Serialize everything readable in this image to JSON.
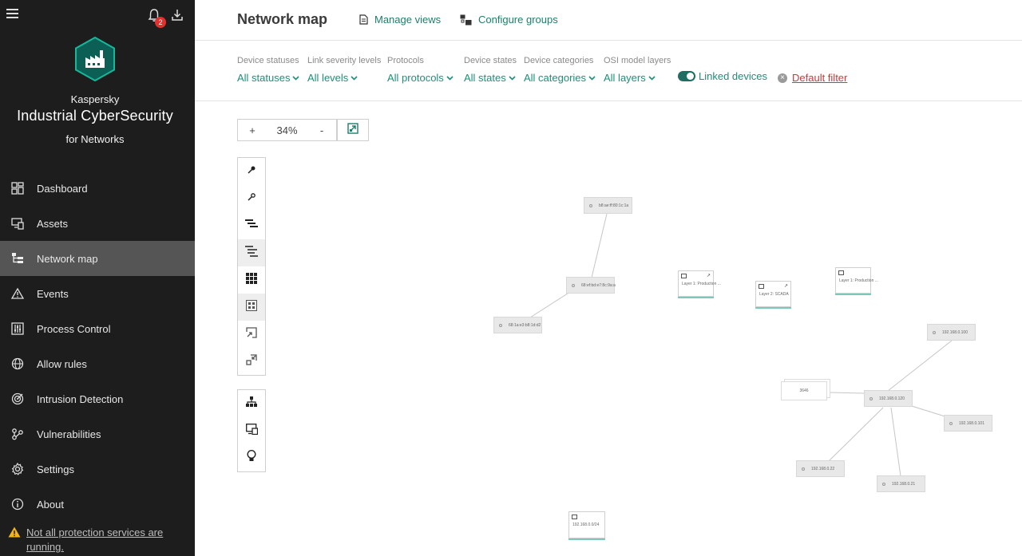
{
  "sidebar": {
    "notification_count": "2",
    "brand": {
      "line1": "Kaspersky",
      "line2": "Industrial CyberSecurity",
      "line3": "for Networks"
    },
    "items": [
      {
        "label": "Dashboard",
        "icon": "dashboard-icon"
      },
      {
        "label": "Assets",
        "icon": "assets-icon"
      },
      {
        "label": "Network map",
        "icon": "network-map-icon"
      },
      {
        "label": "Events",
        "icon": "events-icon"
      },
      {
        "label": "Process Control",
        "icon": "process-control-icon"
      },
      {
        "label": "Allow rules",
        "icon": "globe-icon"
      },
      {
        "label": "Intrusion Detection",
        "icon": "target-icon"
      },
      {
        "label": "Vulnerabilities",
        "icon": "vulnerabilities-icon"
      },
      {
        "label": "Settings",
        "icon": "gear-icon"
      },
      {
        "label": "About",
        "icon": "info-icon"
      }
    ],
    "active_index": 2,
    "warning": "Not all protection services are running."
  },
  "header": {
    "title": "Network map",
    "manage_views": "Manage views",
    "configure_groups": "Configure groups"
  },
  "filters": {
    "device_statuses": {
      "label": "Device statuses",
      "value": "All statuses"
    },
    "link_severity": {
      "label": "Link severity levels",
      "value": "All levels"
    },
    "protocols": {
      "label": "Protocols",
      "value": "All protocols"
    },
    "device_states": {
      "label": "Device states",
      "value": "All states"
    },
    "device_categories": {
      "label": "Device categories",
      "value": "All categories"
    },
    "osi_layers": {
      "label": "OSI model layers",
      "value": "All layers"
    },
    "linked_devices": "Linked devices",
    "default_filter": "Default filter"
  },
  "map": {
    "zoom_plus": "+",
    "zoom_value": "34%",
    "zoom_minus": "-",
    "nodes": [
      {
        "id": "n1",
        "label": "b8:ae:ff:80:1c:1a"
      },
      {
        "id": "n2",
        "label": "68:ef:bd:e7:8c:9a:a"
      },
      {
        "id": "n3",
        "label": "68:1a:e3:b8:1d:d2"
      },
      {
        "id": "n4",
        "label": "192.168.0.100"
      },
      {
        "id": "n5",
        "label": "192.168.0.120"
      },
      {
        "id": "n6",
        "label": "192.168.0.101"
      },
      {
        "id": "n7",
        "label": "192.168.0.22"
      },
      {
        "id": "n8",
        "label": "192.168.0.21"
      }
    ],
    "groups": [
      {
        "id": "g1",
        "label": "Layer 1: Production ..."
      },
      {
        "id": "g2",
        "label": "Layer 2: SCADA"
      },
      {
        "id": "g3",
        "label": "Layer 1: Production ..."
      },
      {
        "id": "g4",
        "label": "192.168.0.0/24"
      }
    ],
    "stack_label": "3646"
  }
}
